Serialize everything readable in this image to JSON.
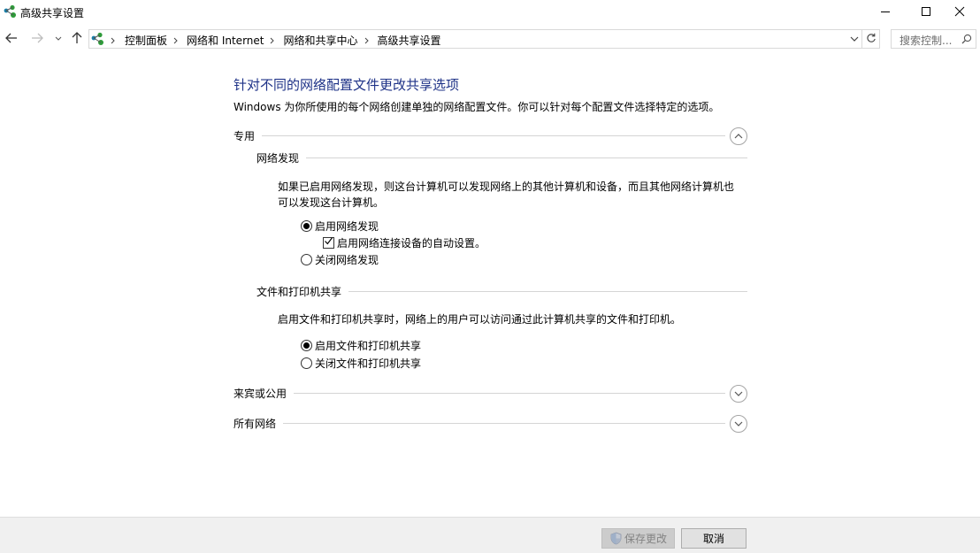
{
  "window": {
    "title": "高级共享设置"
  },
  "address": {
    "breadcrumbs": [
      "控制面板",
      "网络和 Internet",
      "网络和共享中心",
      "高级共享设置"
    ]
  },
  "search": {
    "placeholder": "搜索控制..."
  },
  "main": {
    "heading": "针对不同的网络配置文件更改共享选项",
    "description": "Windows 为你所使用的每个网络创建单独的网络配置文件。你可以针对每个配置文件选择特定的选项。",
    "sections": [
      {
        "label": "专用",
        "expanded": true,
        "subsections": [
          {
            "label": "网络发现",
            "text_line1": "如果已启用网络发现，则这台计算机可以发现网络上的其他计算机和设备，而且其他网络计算机也",
            "text_line2": "可以发现这台计算机。",
            "options": [
              {
                "label": "启用网络发现",
                "type": "radio",
                "checked": true
              },
              {
                "label": "启用网络连接设备的自动设置。",
                "type": "checkbox",
                "checked": true
              },
              {
                "label": "关闭网络发现",
                "type": "radio",
                "checked": false
              }
            ]
          },
          {
            "label": "文件和打印机共享",
            "text_line1": "启用文件和打印机共享时，网络上的用户可以访问通过此计算机共享的文件和打印机。",
            "options": [
              {
                "label": "启用文件和打印机共享",
                "type": "radio",
                "checked": true
              },
              {
                "label": "关闭文件和打印机共享",
                "type": "radio",
                "checked": false
              }
            ]
          }
        ]
      },
      {
        "label": "来宾或公用",
        "expanded": false
      },
      {
        "label": "所有网络",
        "expanded": false
      }
    ]
  },
  "footer": {
    "save_label": "保存更改",
    "save_enabled": false,
    "cancel_label": "取消"
  },
  "colors": {
    "heading": "#1e3287",
    "footer_bg": "#f0f0f0",
    "icon_green": "#2e9b3a",
    "icon_teal": "#1a7fa8"
  },
  "icons": {
    "app": "network-sharing-icon",
    "back": "arrow-left-icon",
    "forward": "arrow-right-icon",
    "recent": "chevron-down-icon",
    "up": "arrow-up-icon",
    "refresh": "refresh-icon",
    "search": "search-icon",
    "shield": "shield-icon"
  }
}
